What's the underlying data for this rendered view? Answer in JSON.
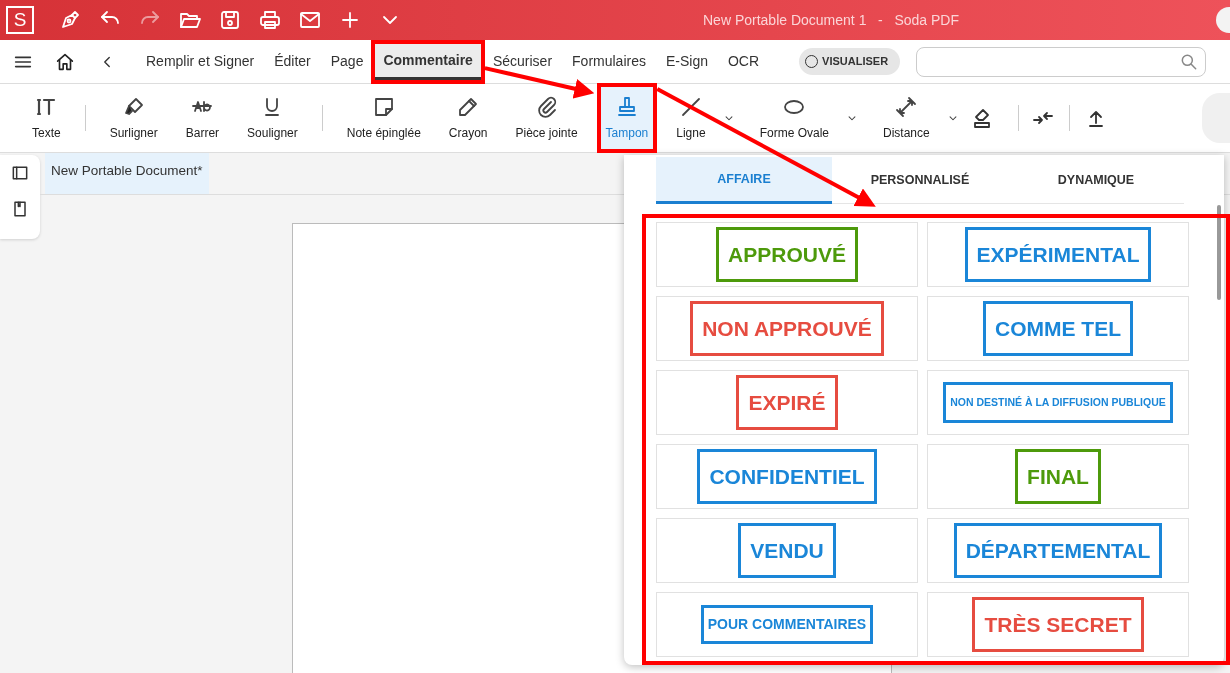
{
  "window": {
    "title": "New Portable Document 1   -   Soda PDF",
    "logo": "S"
  },
  "menu": [
    {
      "label": "Remplir et Signer",
      "selected": false
    },
    {
      "label": "Éditer",
      "selected": false
    },
    {
      "label": "Page",
      "selected": false
    },
    {
      "label": "Commentaire",
      "selected": true
    },
    {
      "label": "Sécuriser",
      "selected": false
    },
    {
      "label": "Formulaires",
      "selected": false
    },
    {
      "label": "E-Sign",
      "selected": false
    },
    {
      "label": "OCR",
      "selected": false
    }
  ],
  "view_toggle": {
    "label": "VISUALISER",
    "on": false
  },
  "tools": [
    {
      "kind": "text",
      "label": "Texte",
      "selected": false
    },
    {
      "kind": "highlight",
      "label": "Surligner",
      "selected": false
    },
    {
      "kind": "strike",
      "label": "Barrer",
      "selected": false
    },
    {
      "kind": "underline",
      "label": "Souligner",
      "selected": false
    },
    {
      "kind": "note",
      "label": "Note épinglée",
      "selected": false
    },
    {
      "kind": "pencil",
      "label": "Crayon",
      "selected": false
    },
    {
      "kind": "attach",
      "label": "Pièce jointe",
      "selected": false
    },
    {
      "kind": "stamp",
      "label": "Tampon",
      "selected": true
    },
    {
      "kind": "line",
      "label": "Ligne",
      "selected": false
    },
    {
      "kind": "oval",
      "label": "Forme Ovale",
      "selected": false
    },
    {
      "kind": "distance",
      "label": "Distance",
      "selected": false
    }
  ],
  "document_tab": {
    "label": "New Portable Document*"
  },
  "stamp_panel": {
    "tabs": [
      {
        "label": "AFFAIRE",
        "selected": true
      },
      {
        "label": "PERSONNALISÉ",
        "selected": false
      },
      {
        "label": "DYNAMIQUE",
        "selected": false
      }
    ],
    "stamps": [
      {
        "label": "APPROUVÉ",
        "color": "#4d9a0b",
        "kind": "large"
      },
      {
        "label": "EXPÉRIMENTAL",
        "color": "#1a86d8",
        "kind": "large"
      },
      {
        "label": "NON APPROUVÉ",
        "color": "#e64c40",
        "kind": "large"
      },
      {
        "label": "COMME TEL",
        "color": "#1a86d8",
        "kind": "large"
      },
      {
        "label": "EXPIRÉ",
        "color": "#e64c40",
        "kind": "large"
      },
      {
        "label": "NON DESTINÉ À LA DIFFUSION PUBLIQUE",
        "color": "#1a86d8",
        "kind": "small"
      },
      {
        "label": "CONFIDENTIEL",
        "color": "#1a86d8",
        "kind": "large"
      },
      {
        "label": "FINAL",
        "color": "#4d9a0b",
        "kind": "large"
      },
      {
        "label": "VENDU",
        "color": "#1a86d8",
        "kind": "large"
      },
      {
        "label": "DÉPARTEMENTAL",
        "color": "#1a86d8",
        "kind": "large"
      },
      {
        "label": "POUR COMMENTAIRES",
        "color": "#1a86d8",
        "kind": "medium"
      },
      {
        "label": "TRÈS SECRET",
        "color": "#e64c40",
        "kind": "large"
      }
    ]
  }
}
